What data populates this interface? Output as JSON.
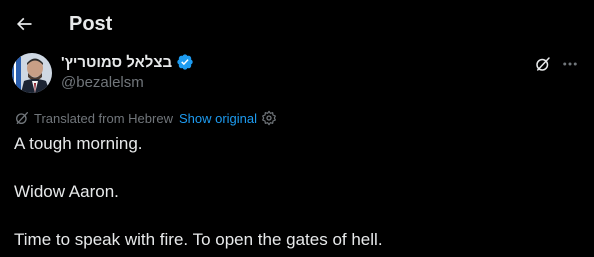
{
  "header": {
    "title": "Post",
    "back_icon": "arrow-left-icon"
  },
  "author": {
    "display_name": "בצלאל סמוטריץ'",
    "handle": "@bezalelsm",
    "verified_icon": "verified-badge-icon",
    "verified_color": "#1d9bf0"
  },
  "actions": {
    "grok_icon": "grok-icon",
    "more_icon": "more-horizontal-icon"
  },
  "translation": {
    "label": "Translated from Hebrew",
    "show_original": "Show original",
    "accent_color": "#1d9bf0"
  },
  "tweet": {
    "paragraphs": [
      "A tough morning.",
      "Widow Aaron.",
      "Time to speak with fire. To open the gates of hell."
    ]
  },
  "colors": {
    "background": "#000000",
    "text_primary": "#e7e9ea",
    "text_secondary": "#71767b"
  }
}
